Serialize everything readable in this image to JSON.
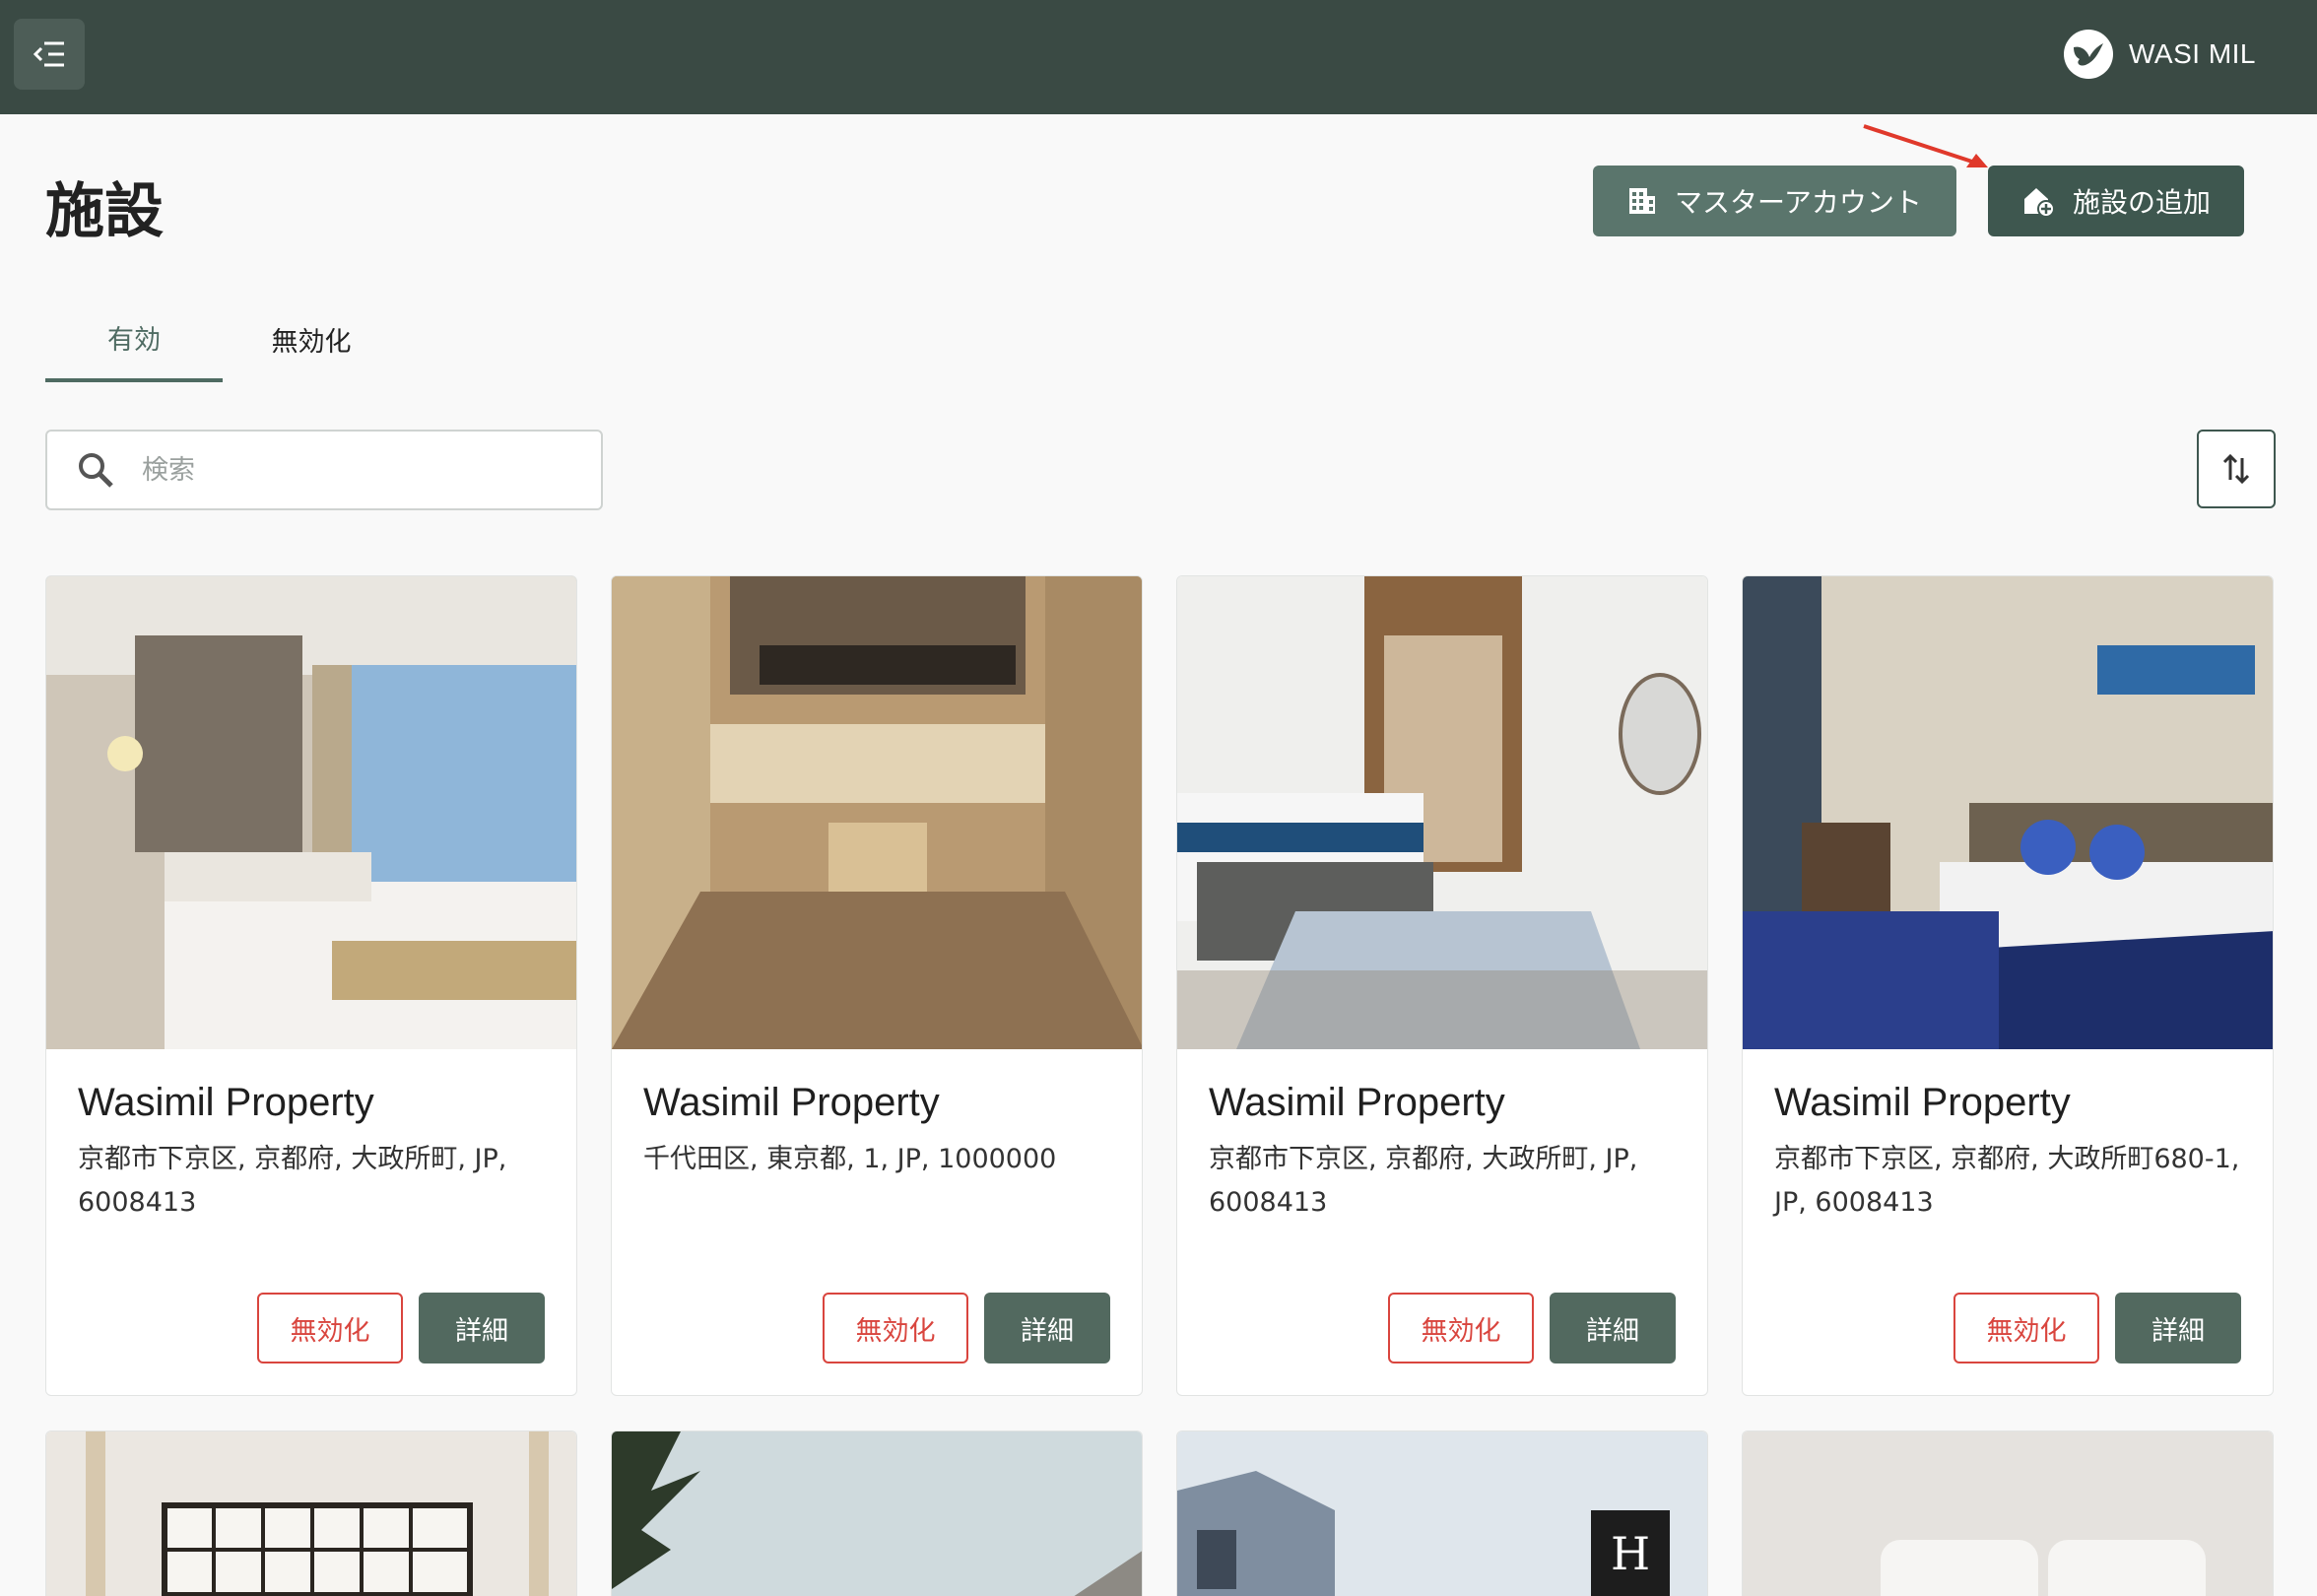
{
  "header": {
    "menu_icon": "collapse-menu-icon",
    "brand_icon": "bird-logo-icon",
    "brand_name": "WASI MIL"
  },
  "page": {
    "title": "施設",
    "master_account_label": "マスターアカウント",
    "master_account_icon": "building-icon",
    "add_facility_label": "施設の追加",
    "add_facility_icon": "house-add-icon"
  },
  "tabs": [
    {
      "label": "有効",
      "active": true
    },
    {
      "label": "無効化",
      "active": false
    }
  ],
  "search": {
    "icon": "search-icon",
    "placeholder": "検索"
  },
  "sort": {
    "icon": "sort-arrows-icon"
  },
  "cards": [
    {
      "title": "Wasimil Property",
      "address": "京都市下京区, 京都府, 大政所町, JP, 6008413",
      "deactivate_label": "無効化",
      "detail_label": "詳細"
    },
    {
      "title": "Wasimil Property",
      "address": "千代田区, 東京都, 1, JP, 1000000",
      "deactivate_label": "無効化",
      "detail_label": "詳細"
    },
    {
      "title": "Wasimil Property",
      "address": "京都市下京区, 京都府, 大政所町, JP, 6008413",
      "deactivate_label": "無効化",
      "detail_label": "詳細"
    },
    {
      "title": "Wasimil Property",
      "address": "京都市下京区, 京都府, 大政所町680-1, JP, 6008413",
      "deactivate_label": "無効化",
      "detail_label": "詳細"
    }
  ],
  "colors": {
    "topbar": "#3a4a44",
    "primary": "#52695f",
    "danger": "#d9453e",
    "annotation_arrow": "#e0392b"
  }
}
